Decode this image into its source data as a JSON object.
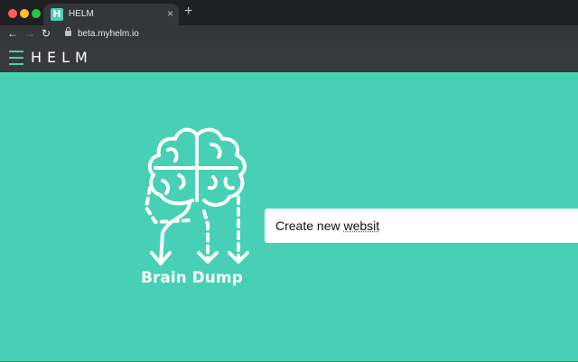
{
  "browser": {
    "tab_title": "HELM",
    "tab_favicon_letter": "H",
    "tab_close": "×",
    "new_tab": "+",
    "url": "beta.myhelm.io",
    "nav": {
      "back": "←",
      "forward": "→",
      "reload": "↻"
    }
  },
  "app": {
    "brand": "HELM"
  },
  "main": {
    "illustration_caption": "Brain Dump",
    "input_text_prefix": "Create new ",
    "input_text_misspelled": "websit"
  },
  "colors": {
    "accent": "#48d0b6",
    "appbar": "#38393b"
  }
}
